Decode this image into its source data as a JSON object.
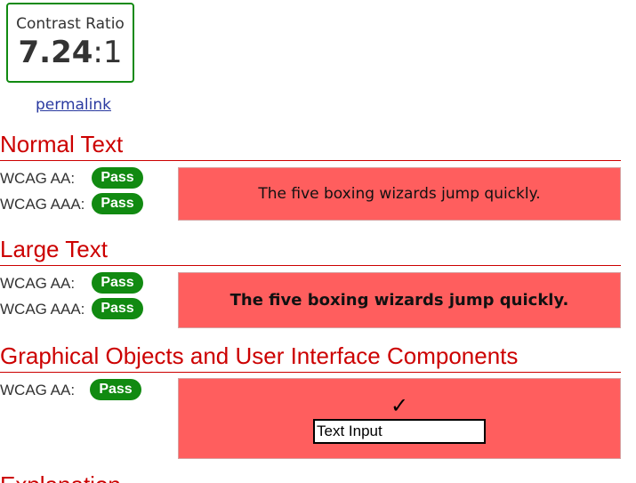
{
  "contrast": {
    "label": "Contrast Ratio",
    "value": "7.24",
    "suffix": ":1"
  },
  "permalink": "permalink",
  "sections": {
    "normal": {
      "title": "Normal Text",
      "aa_label": "WCAG AA:",
      "aa_result": "Pass",
      "aaa_label": "WCAG AAA:",
      "aaa_result": "Pass",
      "sample_text": "The five boxing wizards jump quickly."
    },
    "large": {
      "title": "Large Text",
      "aa_label": "WCAG AA:",
      "aa_result": "Pass",
      "aaa_label": "WCAG AAA:",
      "aaa_result": "Pass",
      "sample_text": "The five boxing wizards jump quickly."
    },
    "graphical": {
      "title": "Graphical Objects and User Interface Components",
      "aa_label": "WCAG AA:",
      "aa_result": "Pass",
      "check_icon": "checkmark-icon",
      "input_placeholder": "Text Input"
    },
    "explanation": {
      "title": "Explanation"
    }
  },
  "colors": {
    "pass_badge": "#118a11",
    "section_title": "#cc0000",
    "sample_background": "#ff5e5e",
    "ratio_border": "#118a11"
  }
}
